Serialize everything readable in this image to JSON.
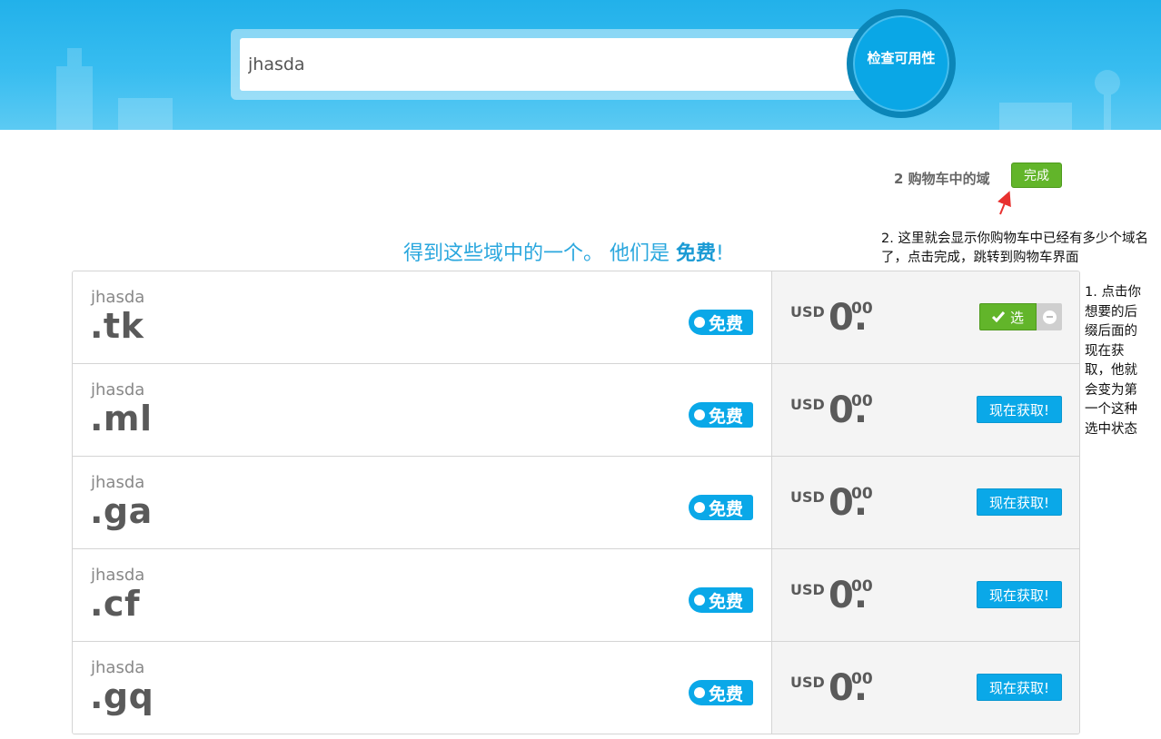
{
  "search": {
    "value": "jhasda",
    "button_label": "检查可用性"
  },
  "cart": {
    "text": "2 购物车中的域",
    "done_label": "完成"
  },
  "heading": {
    "prefix": "得到这些域中的一个。 他们是 ",
    "bold": "免费",
    "suffix": "!"
  },
  "annotations": {
    "note_cart": "2. 这里就会显示你购物车中已经有多少个域名了，点击完成，跳转到购物车界面",
    "note_select": "1. 点击你想要的后缀后面的现在获取，他就会变为第一个这种选中状态"
  },
  "colors": {
    "header_blue": "#22b1ea",
    "accent_blue": "#0aa8e8",
    "green": "#62b52a"
  },
  "domains": [
    {
      "sld": "jhasda",
      "tld": ".tk",
      "badge": "免费",
      "currency": "USD",
      "price_int": "0.",
      "price_dec": "00",
      "state": "selected",
      "selected_label": "选",
      "action_label": "现在获取!"
    },
    {
      "sld": "jhasda",
      "tld": ".ml",
      "badge": "免费",
      "currency": "USD",
      "price_int": "0.",
      "price_dec": "00",
      "state": "available",
      "action_label": "现在获取!"
    },
    {
      "sld": "jhasda",
      "tld": ".ga",
      "badge": "免费",
      "currency": "USD",
      "price_int": "0.",
      "price_dec": "00",
      "state": "available",
      "action_label": "现在获取!"
    },
    {
      "sld": "jhasda",
      "tld": ".cf",
      "badge": "免费",
      "currency": "USD",
      "price_int": "0.",
      "price_dec": "00",
      "state": "available",
      "action_label": "现在获取!"
    },
    {
      "sld": "jhasda",
      "tld": ".gq",
      "badge": "免费",
      "currency": "USD",
      "price_int": "0.",
      "price_dec": "00",
      "state": "available",
      "action_label": "现在获取!"
    }
  ]
}
